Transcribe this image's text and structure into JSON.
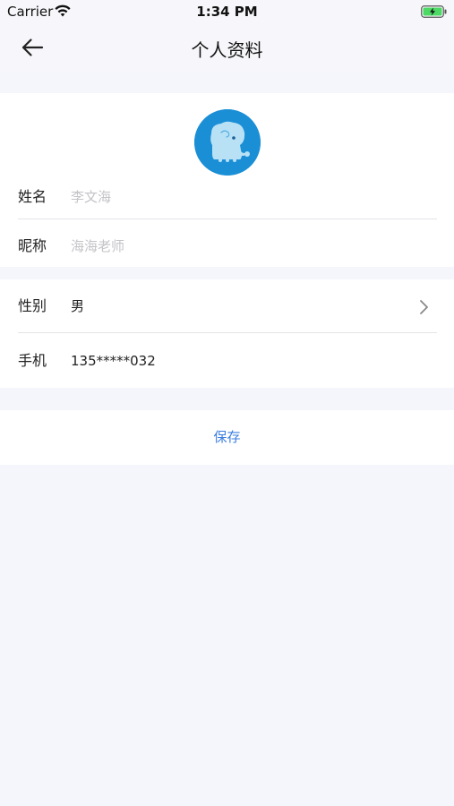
{
  "status_bar": {
    "carrier": "Carrier",
    "time": "1:34 PM",
    "wifi_icon": "wifi-icon",
    "battery_icon": "battery-charging-icon"
  },
  "nav": {
    "title": "个人资料",
    "back_icon": "arrow-left-icon"
  },
  "profile": {
    "avatar_icon": "elephant-avatar",
    "name_label": "姓名",
    "name_value": "李文海",
    "nickname_label": "昵称",
    "nickname_value": "海海老师"
  },
  "info": {
    "gender_label": "性别",
    "gender_value": "男",
    "phone_label": "手机",
    "phone_value": "135*****032"
  },
  "actions": {
    "save_label": "保存"
  },
  "colors": {
    "background": "#f5f5fc",
    "accent": "#3b7de0",
    "avatar_bg": "#1b8fd6",
    "placeholder": "#c3c3c8"
  }
}
